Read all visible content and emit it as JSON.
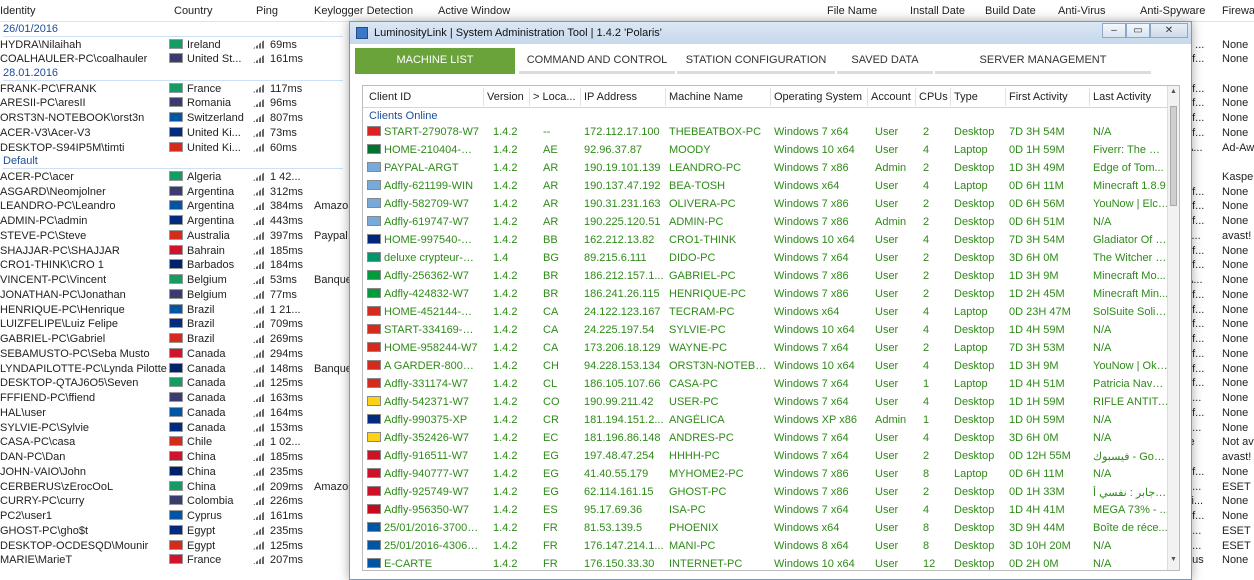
{
  "background": {
    "headers": [
      "Identity",
      "Country",
      "Ping",
      "Keylogger Detection",
      "Active Window",
      "File Name",
      "Install Date",
      "Build Date",
      "Anti-Virus",
      "Anti-Spyware",
      "Firewa"
    ],
    "groups": [
      {
        "label": "26/01/2016",
        "rows": [
          [
            "HYDRA\\Nilaihah",
            "Ireland",
            "69ms",
            "",
            "",
            "",
            "",
            "",
            "p ...",
            "None",
            ""
          ],
          [
            "COALHAULER-PC\\coalhauler",
            "United St...",
            "161ms",
            "",
            "",
            "",
            "",
            "",
            "ef...",
            "None",
            ""
          ]
        ]
      },
      {
        "label": "28.01.2016",
        "rows": [
          [
            "FRANK-PC\\FRANK",
            "France",
            "117ms",
            "",
            "",
            "",
            "",
            "",
            "ef...",
            "None",
            ""
          ],
          [
            "ARESII-PC\\aresII",
            "Romania",
            "96ms",
            "",
            "",
            "",
            "",
            "",
            "ef...",
            "None",
            ""
          ],
          [
            "ORST3N-NOTEBOOK\\orst3n",
            "Switzerland",
            "807ms",
            "",
            "",
            "",
            "",
            "",
            "ef...",
            "None",
            ""
          ],
          [
            "ACER-V3\\Acer-V3",
            "United Ki...",
            "73ms",
            "",
            "",
            "",
            "",
            "",
            "ef...",
            "None",
            ""
          ],
          [
            "DESKTOP-S94IP5M\\timti",
            "United Ki...",
            "60ms",
            "",
            "",
            "",
            "",
            "",
            "A...",
            "Ad-Awa",
            ""
          ]
        ]
      },
      {
        "label": "Default",
        "rows": [
          [
            "ACER-PC\\acer",
            "Algeria",
            "1 42...",
            "",
            "",
            "",
            "",
            "",
            "",
            "Kaspers",
            ""
          ],
          [
            "ASGARD\\Neomjolner",
            "Argentina",
            "312ms",
            "",
            "",
            "",
            "",
            "",
            "ef...",
            "None",
            ""
          ],
          [
            "LEANDRO-PC\\Leandro",
            "Argentina",
            "384ms",
            "Amazon",
            "",
            "",
            "",
            "",
            "ef...",
            "None",
            ""
          ],
          [
            "ADMIN-PC\\admin",
            "Argentina",
            "443ms",
            "",
            "",
            "",
            "",
            "",
            "ef...",
            "None",
            ""
          ],
          [
            "STEVE-PC\\Steve",
            "Australia",
            "397ms",
            "Paypal",
            "",
            "",
            "",
            "",
            "s...",
            "avast!",
            ""
          ],
          [
            "SHAJJAR-PC\\SHAJJAR",
            "Bahrain",
            "185ms",
            "",
            "",
            "",
            "",
            "",
            "ef...",
            "None",
            ""
          ],
          [
            "CRO1-THINK\\CRO 1",
            "Barbados",
            "184ms",
            "",
            "",
            "",
            "",
            "",
            "ef...",
            "None",
            ""
          ],
          [
            "VINCENT-PC\\Vincent",
            "Belgium",
            "53ms",
            "Banque",
            "",
            "",
            "",
            "",
            "A...",
            "None",
            ""
          ],
          [
            "JONATHAN-PC\\Jonathan",
            "Belgium",
            "77ms",
            "",
            "",
            "",
            "",
            "",
            "ef...",
            "None",
            ""
          ],
          [
            "HENRIQUE-PC\\Henrique",
            "Brazil",
            "1 21...",
            "",
            "",
            "",
            "",
            "",
            "ef...",
            "None",
            ""
          ],
          [
            "LUIZFELIPE\\Luiz Felipe",
            "Brazil",
            "709ms",
            "",
            "",
            "",
            "",
            "",
            "ef...",
            "None",
            ""
          ],
          [
            "GABRIEL-PC\\Gabriel",
            "Brazil",
            "269ms",
            "",
            "",
            "",
            "",
            "",
            "ef...",
            "None",
            ""
          ],
          [
            "SEBAMUSTO-PC\\Seba Musto",
            "Canada",
            "294ms",
            "",
            "",
            "",
            "",
            "",
            "ef...",
            "None",
            ""
          ],
          [
            "LYNDAPILOTTE-PC\\Lynda Pilotte",
            "Canada",
            "148ms",
            "Banque",
            "",
            "",
            "",
            "",
            "ef...",
            "None",
            ""
          ],
          [
            "DESKTOP-QTAJ6O5\\Seven",
            "Canada",
            "125ms",
            "",
            "",
            "",
            "",
            "",
            "ef...",
            "None",
            ""
          ],
          [
            "FFFIEND-PC\\ffiend",
            "Canada",
            "163ms",
            "",
            "",
            "",
            "",
            "",
            "e...",
            "None",
            ""
          ],
          [
            "HAL\\user",
            "Canada",
            "164ms",
            "",
            "",
            "",
            "",
            "",
            "ef...",
            "None",
            ""
          ],
          [
            "SYLVIE-PC\\Sylvie",
            "Canada",
            "153ms",
            "",
            "",
            "",
            "",
            "",
            "e...",
            "None",
            ""
          ],
          [
            "CASA-PC\\casa",
            "Chile",
            "1 02...",
            "",
            "",
            "",
            "",
            "",
            "le",
            "Not ava",
            ""
          ],
          [
            "DAN-PC\\Dan",
            "China",
            "185ms",
            "",
            "",
            "",
            "",
            "",
            "",
            "avast!",
            ""
          ],
          [
            "JOHN-VAIO\\John",
            "China",
            "235ms",
            "",
            "",
            "",
            "",
            "",
            "ef...",
            "None",
            ""
          ],
          [
            "CERBERUS\\zErocOoL",
            "China",
            "209ms",
            "Amazon",
            "",
            "",
            "",
            "",
            "t ...",
            "ESET P",
            ""
          ],
          [
            "CURRY-PC\\curry",
            "Colombia",
            "226ms",
            "",
            "",
            "",
            "",
            "",
            "vi...",
            "None",
            ""
          ],
          [
            "PC2\\user1",
            "Cyprus",
            "161ms",
            "",
            "",
            "",
            "",
            "",
            "ef...",
            "None",
            ""
          ],
          [
            "GHOST-PC\\gho$t",
            "Egypt",
            "235ms",
            "",
            "",
            "",
            "",
            "",
            "t ...",
            "ESET P",
            ""
          ],
          [
            "DESKTOP-OCDESQD\\Mounir",
            "Egypt",
            "125ms",
            "",
            "",
            "",
            "",
            "",
            "t ...",
            "ESET P",
            ""
          ],
          [
            "MARIE\\MarieT",
            "France",
            "207ms",
            "",
            "",
            "",
            "",
            "",
            "irus",
            "None",
            ""
          ]
        ]
      }
    ]
  },
  "window": {
    "title": "LuminosityLink | System Administration Tool | 1.4.2 'Polaris'",
    "tabs": [
      "MACHINE LIST",
      "COMMAND AND CONTROL",
      "STATION CONFIGURATION",
      "SAVED DATA",
      "SERVER MANAGEMENT"
    ],
    "columns": [
      "Client ID",
      "Version",
      "> Loca...",
      "IP Address",
      "Machine Name",
      "Operating System",
      "Account",
      "CPUs",
      "Type",
      "First Activity",
      "Last Activity"
    ],
    "group_label": "Clients Online",
    "rows": [
      [
        "START-279078-W7",
        "1.4.2",
        "--",
        "172.112.17.100",
        "THEBEATBOX-PC",
        "Windows 7 x64",
        "User",
        "2",
        "Desktop",
        "7D 3H 54M",
        "N/A"
      ],
      [
        "HOME-210404-W10",
        "1.4.2",
        "AE",
        "92.96.37.87",
        "MOODY",
        "Windows 10 x64",
        "User",
        "4",
        "Laptop",
        "0D 1H 59M",
        "Fiverr: The ma..."
      ],
      [
        "PAYPAL-ARGT",
        "1.4.2",
        "AR",
        "190.19.101.139",
        "LEANDRO-PC",
        "Windows 7 x86",
        "Admin",
        "2",
        "Desktop",
        "1D 3H 49M",
        "Edge of Tom..."
      ],
      [
        "Adfly-621199-WIN",
        "1.4.2",
        "AR",
        "190.137.47.192",
        "BEA-TOSH",
        "Windows x64",
        "User",
        "4",
        "Laptop",
        "0D 6H 11M",
        "Minecraft 1.8.9"
      ],
      [
        "Adfly-582709-W7",
        "1.4.2",
        "AR",
        "190.31.231.163",
        "OLIVERA-PC",
        "Windows 7 x86",
        "User",
        "2",
        "Desktop",
        "0D 6H 56M",
        "YouNow | Elch..."
      ],
      [
        "Adfly-619747-W7",
        "1.4.2",
        "AR",
        "190.225.120.51",
        "ADMIN-PC",
        "Windows 7 x86",
        "Admin",
        "2",
        "Desktop",
        "0D 6H 51M",
        "N/A"
      ],
      [
        "HOME-997540-W10",
        "1.4.2",
        "BB",
        "162.212.13.82",
        "CRO1-THINK",
        "Windows 10 x64",
        "User",
        "4",
        "Desktop",
        "7D 3H 54M",
        "Gladiator Of P..."
      ],
      [
        "deluxe crypteur-14...",
        "1.4",
        "BG",
        "89.215.6.111",
        "DIDO-PC",
        "Windows 7 x64",
        "User",
        "2",
        "Desktop",
        "3D 6H 0M",
        "The Witcher 3:..."
      ],
      [
        "Adfly-256362-W7",
        "1.4.2",
        "BR",
        "186.212.157.1...",
        "GABRIEL-PC",
        "Windows 7 x86",
        "User",
        "2",
        "Desktop",
        "1D 3H 9M",
        "Minecraft Mo..."
      ],
      [
        "Adfly-424832-W7",
        "1.4.2",
        "BR",
        "186.241.26.115",
        "HENRIQUE-PC",
        "Windows 7 x86",
        "User",
        "2",
        "Desktop",
        "1D 2H 45M",
        "Minecraft Min..."
      ],
      [
        "HOME-452144-WIN",
        "1.4.2",
        "CA",
        "24.122.123.167",
        "TECRAM-PC",
        "Windows x64",
        "User",
        "4",
        "Laptop",
        "0D 23H 47M",
        "SolSuite Solita..."
      ],
      [
        "START-334169-W10",
        "1.4.2",
        "CA",
        "24.225.197.54",
        "SYLVIE-PC",
        "Windows 10 x64",
        "User",
        "4",
        "Desktop",
        "1D 4H 59M",
        "N/A"
      ],
      [
        "HOME-958244-W7",
        "1.4.2",
        "CA",
        "173.206.18.129",
        "WAYNE-PC",
        "Windows 7 x64",
        "User",
        "2",
        "Laptop",
        "7D 3H 53M",
        "N/A"
      ],
      [
        "A GARDER-800995...",
        "1.4.2",
        "CH",
        "94.228.153.134",
        "ORST3N-NOTEBO...",
        "Windows 10 x64",
        "User",
        "4",
        "Desktop",
        "1D 3H 9M",
        "YouNow | Oka..."
      ],
      [
        "Adfly-331174-W7",
        "1.4.2",
        "CL",
        "186.105.107.66",
        "CASA-PC",
        "Windows 7 x64",
        "User",
        "1",
        "Laptop",
        "1D 4H 51M",
        "Patricia Navar..."
      ],
      [
        "Adfly-542371-W7",
        "1.4.2",
        "CO",
        "190.99.211.42",
        "USER-PC",
        "Windows 7 x64",
        "User",
        "4",
        "Desktop",
        "1D 1H 59M",
        "RIFLE ANTITA..."
      ],
      [
        "Adfly-990375-XP",
        "1.4.2",
        "CR",
        "181.194.151.2...",
        "ANGÉLICA",
        "Windows XP x86",
        "Admin",
        "1",
        "Desktop",
        "1D 0H 59M",
        "N/A"
      ],
      [
        "Adfly-352426-W7",
        "1.4.2",
        "EC",
        "181.196.86.148",
        "ANDRES-PC",
        "Windows 7 x64",
        "User",
        "4",
        "Desktop",
        "3D 6H 0M",
        "N/A"
      ],
      [
        "Adfly-916511-W7",
        "1.4.2",
        "EG",
        "197.48.47.254",
        "HHHH-PC",
        "Windows 7 x64",
        "User",
        "2",
        "Desktop",
        "0D 12H 55M",
        "فيسبوك - Googl..."
      ],
      [
        "Adfly-940777-W7",
        "1.4.2",
        "EG",
        "41.40.55.179",
        "MYHOME2-PC",
        "Windows 7 x86",
        "User",
        "8",
        "Laptop",
        "0D 6H 11M",
        "N/A"
      ],
      [
        "Adfly-925749-W7",
        "1.4.2",
        "EG",
        "62.114.161.15",
        "GHOST-PC",
        "Windows 7 x86",
        "User",
        "2",
        "Desktop",
        "0D 1H 33M",
        "عمر جابر : نفسي أ..."
      ],
      [
        "Adfly-956350-W7",
        "1.4.2",
        "ES",
        "95.17.69.36",
        "ISA-PC",
        "Windows 7 x64",
        "User",
        "4",
        "Desktop",
        "1D 4H 41M",
        "MEGA 73% - ..."
      ],
      [
        "25/01/2016-37007...",
        "1.4.2",
        "FR",
        "81.53.139.5",
        "PHOENIX",
        "Windows x64",
        "User",
        "8",
        "Desktop",
        "3D 9H 44M",
        "Boîte de réce..."
      ],
      [
        "25/01/2016-43064...",
        "1.4.2",
        "FR",
        "176.147.214.1...",
        "MANI-PC",
        "Windows 8 x64",
        "User",
        "8",
        "Desktop",
        "3D 10H 20M",
        "N/A"
      ],
      [
        "E-CARTE",
        "1.4.2",
        "FR",
        "176.150.33.30",
        "INTERNET-PC",
        "Windows 10 x64",
        "User",
        "12",
        "Desktop",
        "0D 2H 0M",
        "N/A"
      ]
    ]
  },
  "colors": {
    "accent_green": "#6aa33a",
    "row_text": "#2f8a1a",
    "group_blue": "#1a4f9c"
  }
}
